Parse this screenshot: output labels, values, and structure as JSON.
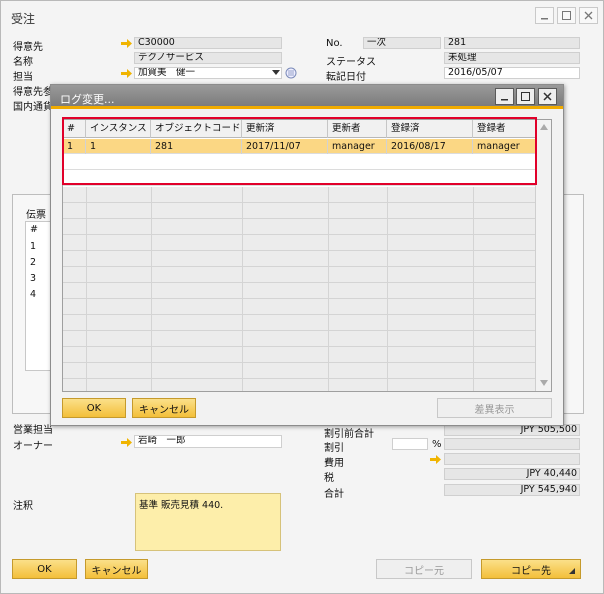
{
  "window": {
    "title": "受注"
  },
  "header_left": [
    {
      "label": "得意先",
      "value": "C30000"
    },
    {
      "label": "名称",
      "value": "テクノサービス"
    },
    {
      "label": "担当",
      "value": "加賀美　健一"
    },
    {
      "label": "得意先参",
      "value": ""
    },
    {
      "label": "国内通貨",
      "value": ""
    }
  ],
  "header_right": [
    {
      "label": "No.",
      "series": "一次",
      "value": "281"
    },
    {
      "label": "ステータス",
      "value": "未処理"
    },
    {
      "label": "転記日付",
      "value": "2016/05/07"
    }
  ],
  "tab": {
    "label": "伝票",
    "rows": [
      "#",
      "1",
      "2",
      "3",
      "4"
    ]
  },
  "bottom_left": [
    {
      "label": "営業担当",
      "value": ""
    },
    {
      "label": "オーナー",
      "value": "岩崎　一郎"
    },
    {
      "label": "注釈",
      "value": "基準 販売見積 440."
    }
  ],
  "bottom_right": [
    {
      "label": "割引前合計",
      "value": "JPY 505,500"
    },
    {
      "label": "割引",
      "value": "",
      "unit": "%"
    },
    {
      "label": "費用",
      "value": ""
    },
    {
      "label": "税",
      "value": "JPY 40,440"
    },
    {
      "label": "合計",
      "value": "JPY 545,940"
    }
  ],
  "footer": {
    "ok": "OK",
    "cancel": "キャンセル",
    "copy_from": "コピー元",
    "copy_to": "コピー先"
  },
  "dialog": {
    "title": "ログ変更...",
    "columns": [
      "#",
      "インスタンス",
      "オブジェクトコード",
      "更新済",
      "更新者",
      "登録済",
      "登録者"
    ],
    "rows": [
      [
        "1",
        "1",
        "281",
        "2017/11/07",
        "manager",
        "2016/08/17",
        "manager"
      ]
    ],
    "ok": "OK",
    "cancel": "キャンセル",
    "diff": "差異表示"
  },
  "colors": {
    "highlight": "#e1002a",
    "accent": "#f0ab00",
    "selected_row": "#fbd784"
  }
}
